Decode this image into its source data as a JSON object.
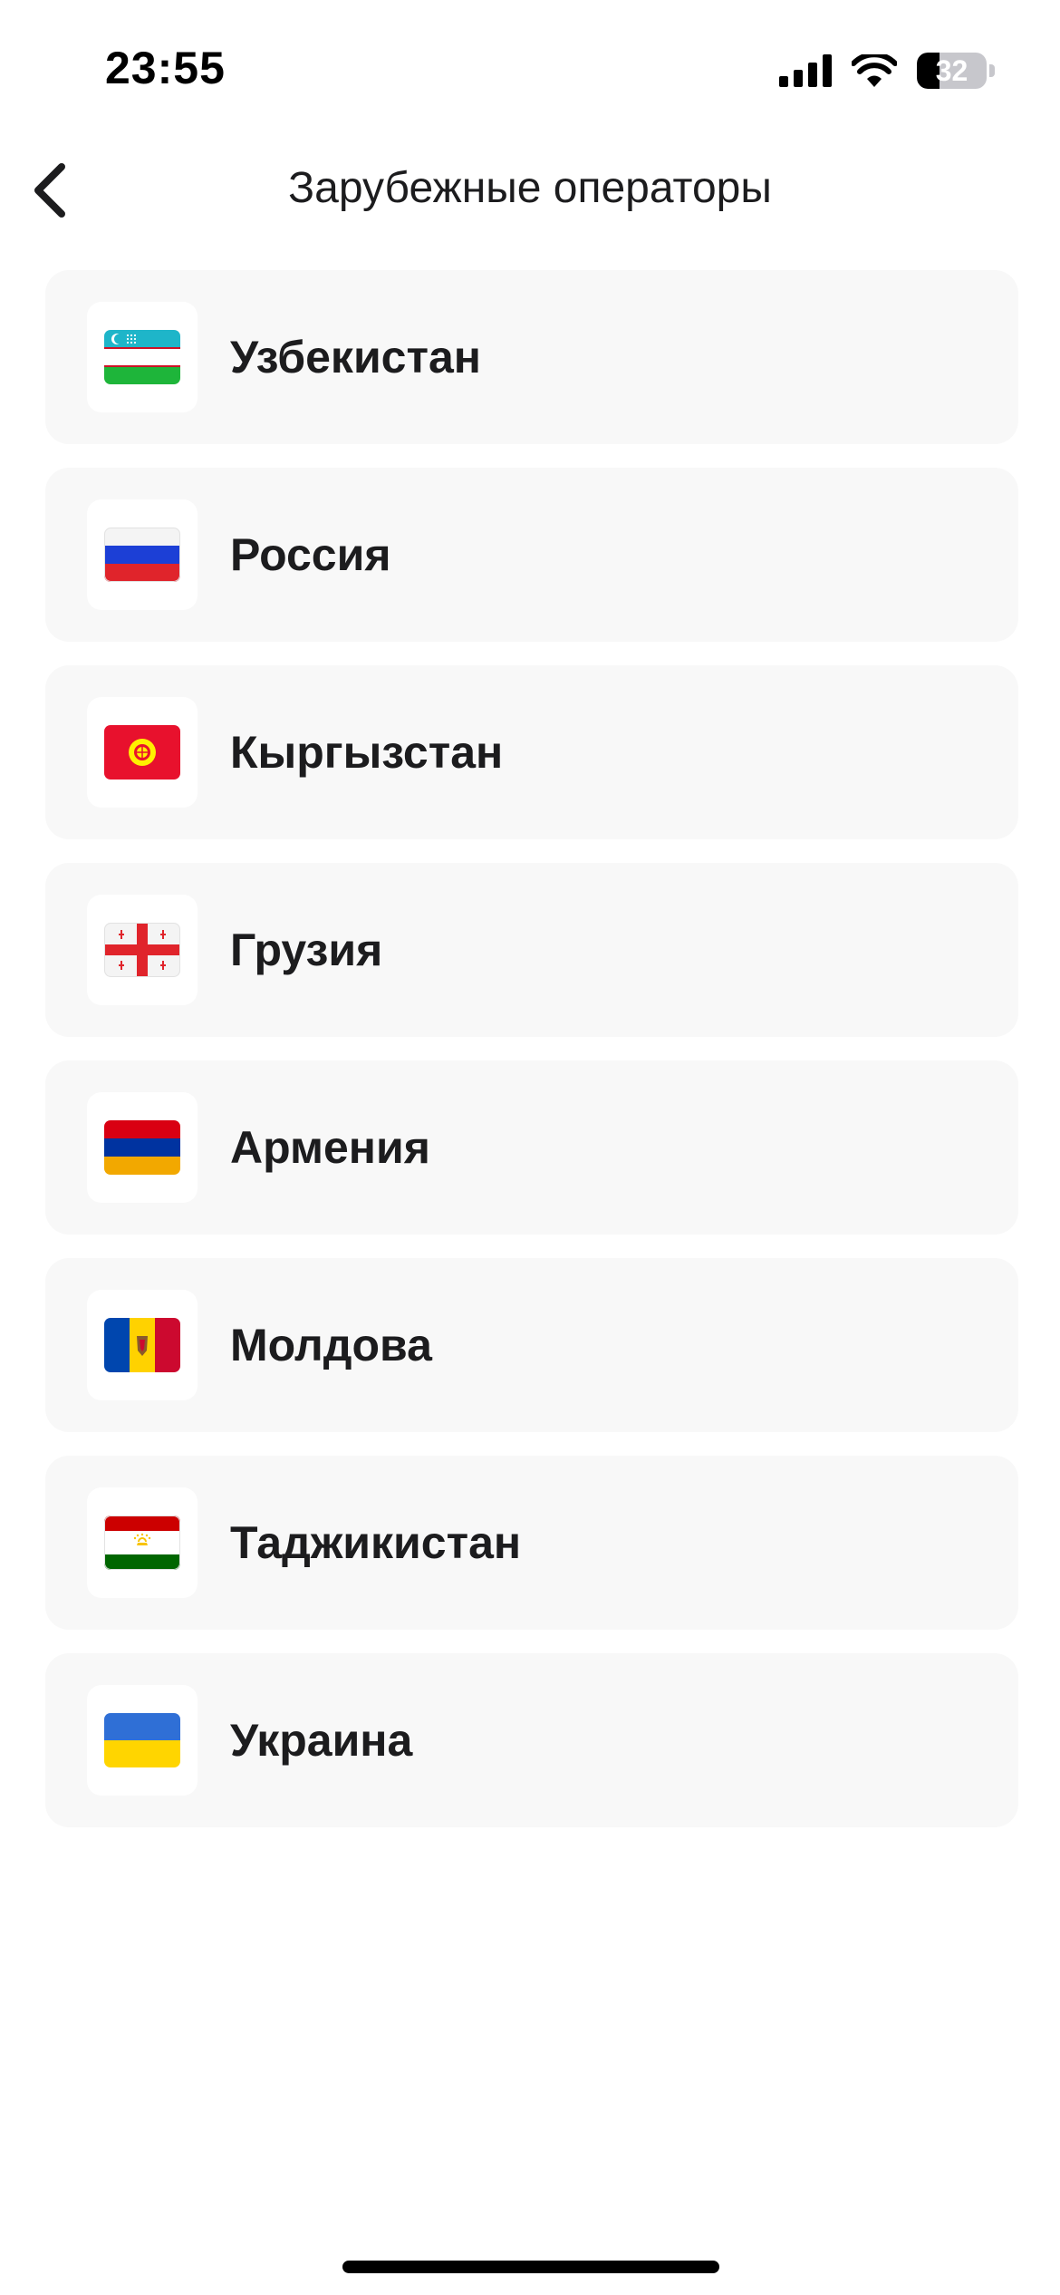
{
  "status_bar": {
    "time": "23:55",
    "battery_level": "32",
    "battery_fraction": 0.32,
    "icons": [
      "signal-icon",
      "wifi-icon",
      "battery-icon"
    ]
  },
  "header": {
    "back_icon": "chevron-left-icon",
    "title": "Зарубежные операторы"
  },
  "countries": [
    {
      "name": "Узбекистан",
      "flag": "uzbekistan-flag-icon"
    },
    {
      "name": "Россия",
      "flag": "russia-flag-icon"
    },
    {
      "name": "Кыргызстан",
      "flag": "kyrgyzstan-flag-icon"
    },
    {
      "name": "Грузия",
      "flag": "georgia-flag-icon"
    },
    {
      "name": "Армения",
      "flag": "armenia-flag-icon"
    },
    {
      "name": "Молдова",
      "flag": "moldova-flag-icon"
    },
    {
      "name": "Таджикистан",
      "flag": "tajikistan-flag-icon"
    },
    {
      "name": "Украина",
      "flag": "ukraine-flag-icon"
    }
  ],
  "colors": {
    "card_background": "#f8f8f8",
    "text_primary": "#1c1c1e",
    "page_background": "#ffffff"
  }
}
